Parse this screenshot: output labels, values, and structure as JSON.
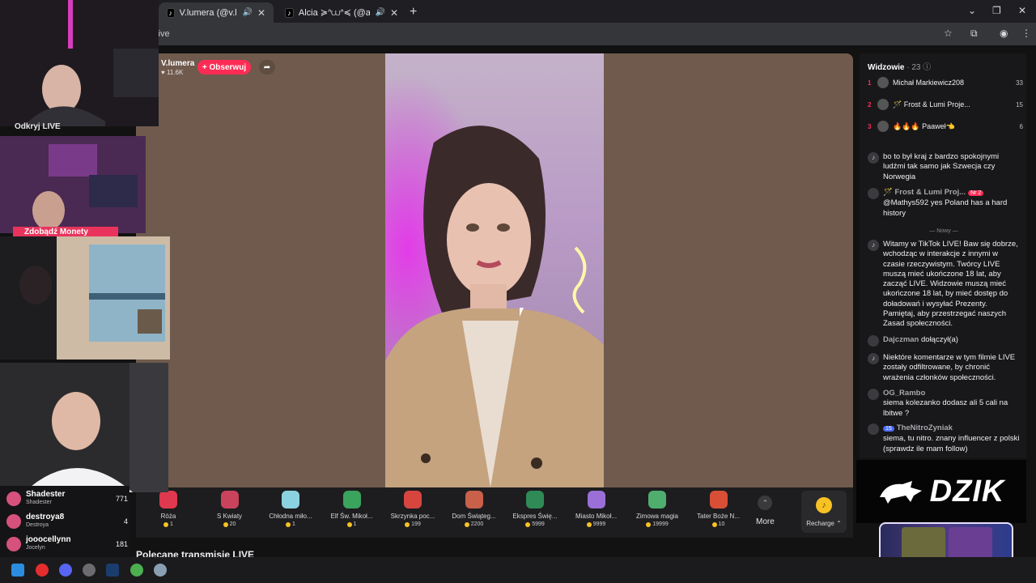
{
  "browser": {
    "tabs": [
      {
        "label": "V.lumera (@v.lumera) prow",
        "active": true
      },
      {
        "label": "Alcia ≽ᐢ⩊ᐢ≼ (@alciaaaxo) pro",
        "active": false
      }
    ],
    "url": "/live"
  },
  "host": {
    "name": "V.lumera",
    "likes": "11.6K",
    "follow_label": "+ Obserwuj"
  },
  "gifts": [
    {
      "name": "Róża",
      "price": "1",
      "color": "#e0384e"
    },
    {
      "name": "S Kwiaty",
      "price": "20",
      "color": "#c9435c"
    },
    {
      "name": "Chłodna miło...",
      "price": "1",
      "color": "#8bd2e0"
    },
    {
      "name": "Elf Św. Mikoł...",
      "price": "1",
      "color": "#3aa35c"
    },
    {
      "name": "Skrzynka poc...",
      "price": "199",
      "color": "#d6463f"
    },
    {
      "name": "Dom Świąteg...",
      "price": "2200",
      "color": "#c8604a"
    },
    {
      "name": "Ekspres Świę...",
      "price": "5999",
      "color": "#2f8a56"
    },
    {
      "name": "Miasto Mikoł...",
      "price": "9999",
      "color": "#9a6fd8"
    },
    {
      "name": "Zimowa magia",
      "price": "19999",
      "color": "#4fae6e"
    },
    {
      "name": "Tater Boże N...",
      "price": "10",
      "color": "#d94f36"
    }
  ],
  "more_label": "More",
  "recharge_label": "Recharge ⌃",
  "recommended_label": "Polecane transmisje LIVE",
  "viewers": {
    "label": "Widzowie",
    "count": "· 23",
    "top": [
      {
        "rank": "1",
        "name": "Michał Markiewicz208",
        "score": "33"
      },
      {
        "rank": "2",
        "name": "🪄 Frost & Lumi Proje...",
        "score": "15"
      },
      {
        "rank": "3",
        "name": "🔥🔥🔥 Paaweł👈",
        "score": "6"
      }
    ]
  },
  "chat": [
    {
      "user": "",
      "text": "bo to był kraj z bardzo spokojnymi ludźmi tak samo jak Szwecja czy Norwegia"
    },
    {
      "user": "🪄 Frost & Lumi Proj...",
      "badge": "Nr 2",
      "text": "@Mathys592 yes Poland has a hard history"
    },
    {
      "user": "",
      "text": "Witamy w TikTok LIVE! Baw się dobrze, wchodząc w interakcje z innymi w czasie rzeczywistym. Twórcy LIVE muszą mieć ukończone 18 lat, aby zacząć LIVE. Widzowie muszą mieć ukończone 18 lat, by mieć dostęp do doładowań i wysyłać Prezenty. Pamiętaj, aby przestrzegać naszych Zasad społeczności."
    },
    {
      "user": "Dajczman",
      "text": "dołączył(a)"
    },
    {
      "user": "",
      "text": "Niektóre komentarze w tym filmie LIVE zostały odfiltrowane, by chronić wrażenia członków społeczności."
    },
    {
      "user": "OG_Rambo",
      "text": "siema kolezanko dodasz ali 5 cali na lbitwe ?"
    },
    {
      "user": "TheNitroZyniak",
      "badge2": "15",
      "text": "siema, tu nitro. znany influencer z polski (sprawdz ile mam follow)"
    }
  ],
  "new_separator": "Nowy",
  "sponsor": "DZIK",
  "overlay": {
    "live_label": "Odkryj LIVE",
    "coins_label": "Zdobądź Monety"
  },
  "left_list": [
    {
      "name": "Shadester",
      "sub": "Shadester",
      "count": "771"
    },
    {
      "name": "destroya8",
      "sub": "Destroya",
      "count": "4"
    },
    {
      "name": "jooocellynn",
      "sub": "Jocelyn",
      "count": "181"
    }
  ]
}
